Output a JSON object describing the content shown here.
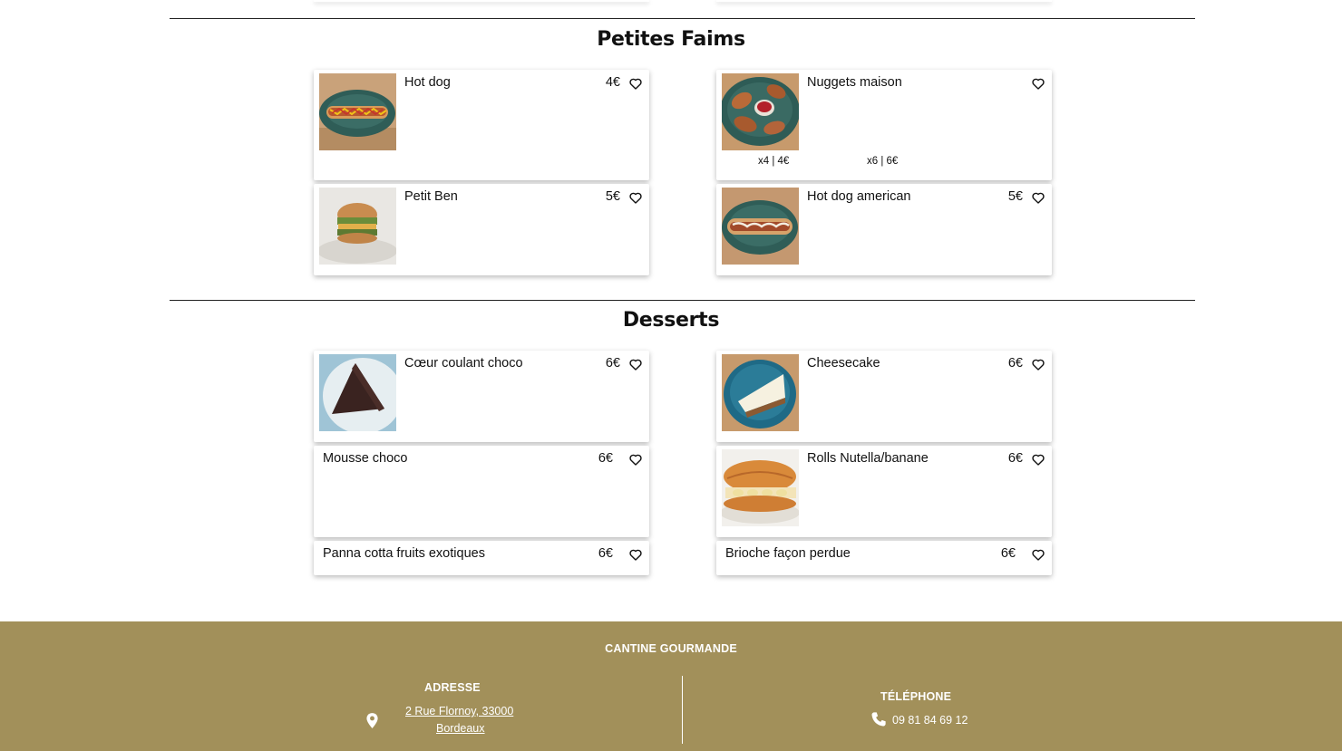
{
  "sections": [
    {
      "title": "Petites Faims",
      "items": [
        {
          "name": "Hot dog",
          "price": "4€"
        },
        {
          "name": "Nuggets maison",
          "price": "",
          "variants": [
            "x4 | 4€",
            "x6 | 6€"
          ]
        },
        {
          "name": "Petit Ben",
          "price": "5€"
        },
        {
          "name": "Hot dog american",
          "price": "5€"
        }
      ]
    },
    {
      "title": "Desserts",
      "items": [
        {
          "name": "Cœur coulant choco",
          "price": "6€"
        },
        {
          "name": "Cheesecake",
          "price": "6€"
        },
        {
          "name": "Mousse choco",
          "price": "6€"
        },
        {
          "name": "Rolls Nutella/banane",
          "price": "6€"
        },
        {
          "name": "Panna cotta fruits exotiques",
          "price": "6€"
        },
        {
          "name": "Brioche façon perdue",
          "price": "6€"
        }
      ]
    }
  ],
  "footer": {
    "brand": "CANTINE GOURMANDE",
    "address_label": "ADRESSE",
    "address_line1": "2 Rue Flornoy, 33000",
    "address_line2": "Bordeaux",
    "phone_label": "TÉLÉPHONE",
    "phone": "09 81 84 69 12",
    "background_color": "#a2905a"
  },
  "icons": {
    "favorite": "heart-icon",
    "location": "map-pin-icon",
    "phone": "phone-icon"
  }
}
